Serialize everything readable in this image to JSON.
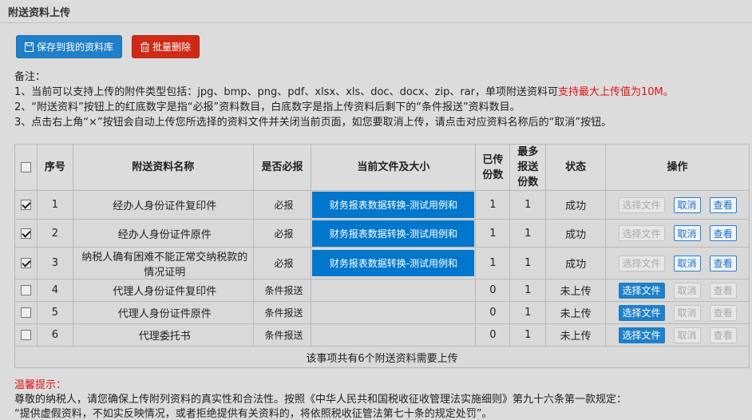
{
  "page": {
    "title": "附送资料上传"
  },
  "toolbar": {
    "save_label": "保存到我的资料库",
    "delete_label": "批量删除",
    "accent_blue": "#1f80c9",
    "accent_red": "#d02a16"
  },
  "notes": {
    "heading": "备注：",
    "line1_a": "1、当前可以支持上传的附件类型包括：jpg、bmp、png、pdf、xlsx、xls、doc、docx、zip、rar，单项附送资料可",
    "line1_b": "支持最大上传值为10M。",
    "line2": "2、“附送资料”按钮上的红底数字是指“必报”资料数目，白底数字是指上传资料后剩下的“条件报送”资料数目。",
    "line3": "3、点击右上角“×”按钮会自动上传您所选择的资料文件并关闭当前页面，如您要取消上传，请点击对应资料名称后的“取消”按钮。"
  },
  "table": {
    "headers": {
      "seq": "序号",
      "name": "附送资料名称",
      "required": "是否必报",
      "file": "当前文件及大小",
      "uploaded_1": "已传",
      "uploaded_2": "份数",
      "max_1": "最多",
      "max_2": "报送",
      "max_3": "份数",
      "status": "状态",
      "ops": "操作"
    },
    "rows": [
      {
        "seq": "1",
        "name": "经办人身份证件复印件",
        "required": "必报",
        "file": "财务报表数据转换-测试用例和",
        "uploaded": "1",
        "max": "1",
        "status": "成功",
        "choose": "选择文件",
        "cancel": "取消",
        "view": "查看"
      },
      {
        "seq": "2",
        "name": "经办人身份证件原件",
        "required": "必报",
        "file": "财务报表数据转换-测试用例和",
        "uploaded": "1",
        "max": "1",
        "status": "成功",
        "choose": "选择文件",
        "cancel": "取消",
        "view": "查看"
      },
      {
        "seq": "3",
        "name": "纳税人确有困难不能正常交纳税款的情况证明",
        "required": "必报",
        "file": "财务报表数据转换-测试用例和",
        "uploaded": "1",
        "max": "1",
        "status": "成功",
        "choose": "选择文件",
        "cancel": "取消",
        "view": "查看"
      },
      {
        "seq": "4",
        "name": "代理人身份证件复印件",
        "required": "条件报送",
        "file": "",
        "uploaded": "0",
        "max": "1",
        "status": "未上传",
        "choose": "选择文件",
        "cancel": "取消",
        "view": "查看"
      },
      {
        "seq": "5",
        "name": "代理人身份证件原件",
        "required": "条件报送",
        "file": "",
        "uploaded": "0",
        "max": "1",
        "status": "未上传",
        "choose": "选择文件",
        "cancel": "取消",
        "view": "查看"
      },
      {
        "seq": "6",
        "name": "代理委托书",
        "required": "条件报送",
        "file": "",
        "uploaded": "0",
        "max": "1",
        "status": "未上传",
        "choose": "选择文件",
        "cancel": "取消",
        "view": "查看"
      }
    ],
    "footer": "该事项共有6个附送资料需要上传"
  },
  "tips": {
    "title": "温馨提示：",
    "line1": "尊敬的纳税人，请您确保上传附列资料的真实性和合法性。按照《中华人民共和国税收征收管理法实施细则》第九十六条第一款规定：",
    "line2": "“提供虚假资料，不如实反映情况，或者拒绝提供有关资料的，将依照税收征管法第七十条的规定处罚”。"
  }
}
